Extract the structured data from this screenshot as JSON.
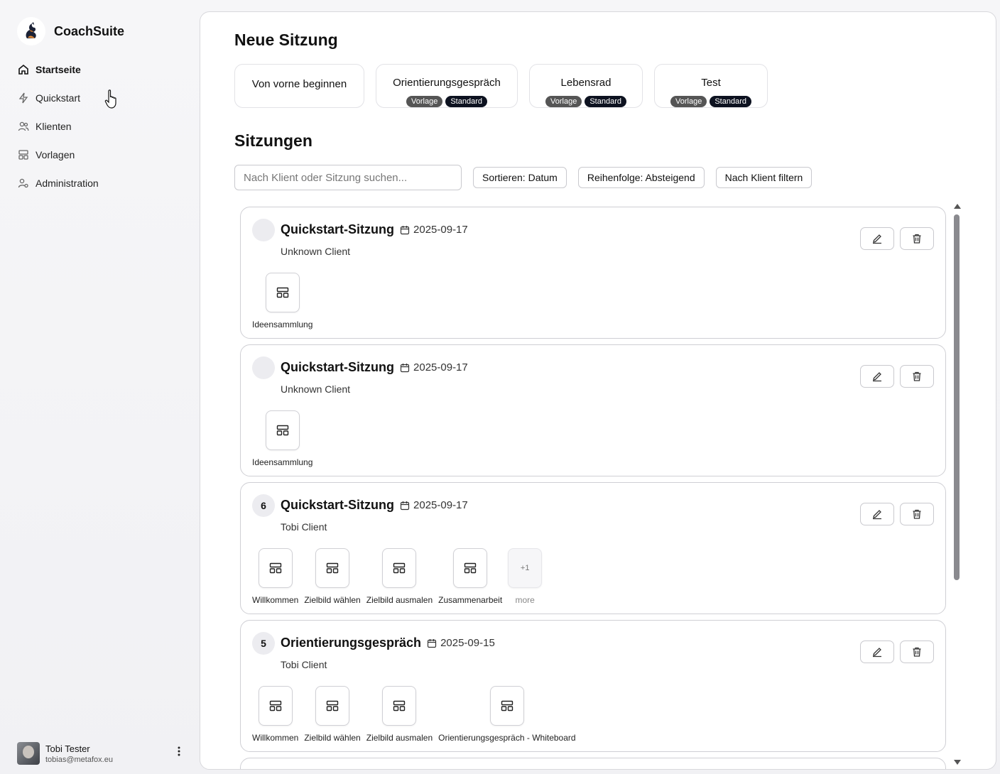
{
  "brand": {
    "name": "CoachSuite"
  },
  "nav": [
    {
      "label": "Startseite",
      "icon": "home-icon",
      "active": true
    },
    {
      "label": "Quickstart",
      "icon": "lightning-icon"
    },
    {
      "label": "Klienten",
      "icon": "users-icon"
    },
    {
      "label": "Vorlagen",
      "icon": "layout-icon"
    },
    {
      "label": "Administration",
      "icon": "user-settings-icon"
    }
  ],
  "user": {
    "name": "Tobi Tester",
    "email": "tobias@metafox.eu"
  },
  "new_session": {
    "title": "Neue Sitzung",
    "templates": [
      {
        "label": "Von vorne beginnen"
      },
      {
        "label": "Orientierungsgespräch",
        "badges": [
          "Vorlage",
          "Standard"
        ]
      },
      {
        "label": "Lebensrad",
        "badges": [
          "Vorlage",
          "Standard"
        ]
      },
      {
        "label": "Test",
        "badges": [
          "Vorlage",
          "Standard"
        ]
      }
    ]
  },
  "sessions": {
    "title": "Sitzungen",
    "search_placeholder": "Nach Klient oder Sitzung suchen...",
    "sort_label": "Sortieren: Datum",
    "order_label": "Reihenfolge: Absteigend",
    "filter_label": "Nach Klient filtern",
    "items": [
      {
        "num": "",
        "title": "Quickstart-Sitzung",
        "date": "2025-09-17",
        "client": "Unknown Client",
        "steps": [
          {
            "label": "Ideensammlung"
          }
        ]
      },
      {
        "num": "",
        "title": "Quickstart-Sitzung",
        "date": "2025-09-17",
        "client": "Unknown Client",
        "steps": [
          {
            "label": "Ideensammlung"
          }
        ]
      },
      {
        "num": "6",
        "title": "Quickstart-Sitzung",
        "date": "2025-09-17",
        "client": "Tobi Client",
        "steps": [
          {
            "label": "Willkommen"
          },
          {
            "label": "Zielbild wählen"
          },
          {
            "label": "Zielbild ausmalen"
          },
          {
            "label": "Zusammenarbeit"
          },
          {
            "label": "more",
            "more": "+1"
          }
        ]
      },
      {
        "num": "5",
        "title": "Orientierungsgespräch",
        "date": "2025-09-15",
        "client": "Tobi Client",
        "steps": [
          {
            "label": "Willkommen"
          },
          {
            "label": "Zielbild wählen"
          },
          {
            "label": "Zielbild ausmalen"
          },
          {
            "label": "Orientierungsgespräch - Whiteboard"
          }
        ]
      }
    ]
  },
  "colors": {
    "badge_gray": "#555555",
    "badge_dark": "#0d1220",
    "accent": "#111111"
  }
}
